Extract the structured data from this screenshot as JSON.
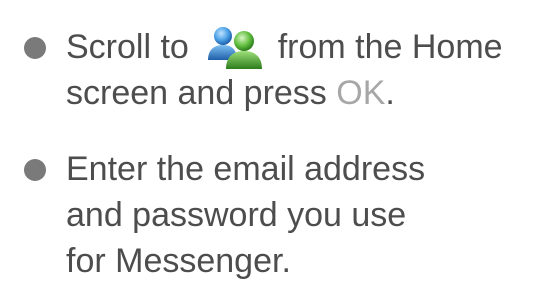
{
  "steps": [
    {
      "line1_before_icon": "Scroll to",
      "icon": "messenger-icon",
      "line1_after_icon": "from the Home",
      "line2_before_key": "screen and press",
      "key": "OK",
      "line2_after_key": "."
    },
    {
      "line1": "Enter the email address",
      "line2": "and password you use",
      "line3": "for Messenger."
    }
  ],
  "colors": {
    "text": "#4d4d4d",
    "bullet": "#7a7a7a",
    "key": "#a7a7a7",
    "icon_blue": "#3c8fd6",
    "icon_green": "#5cb83a"
  }
}
